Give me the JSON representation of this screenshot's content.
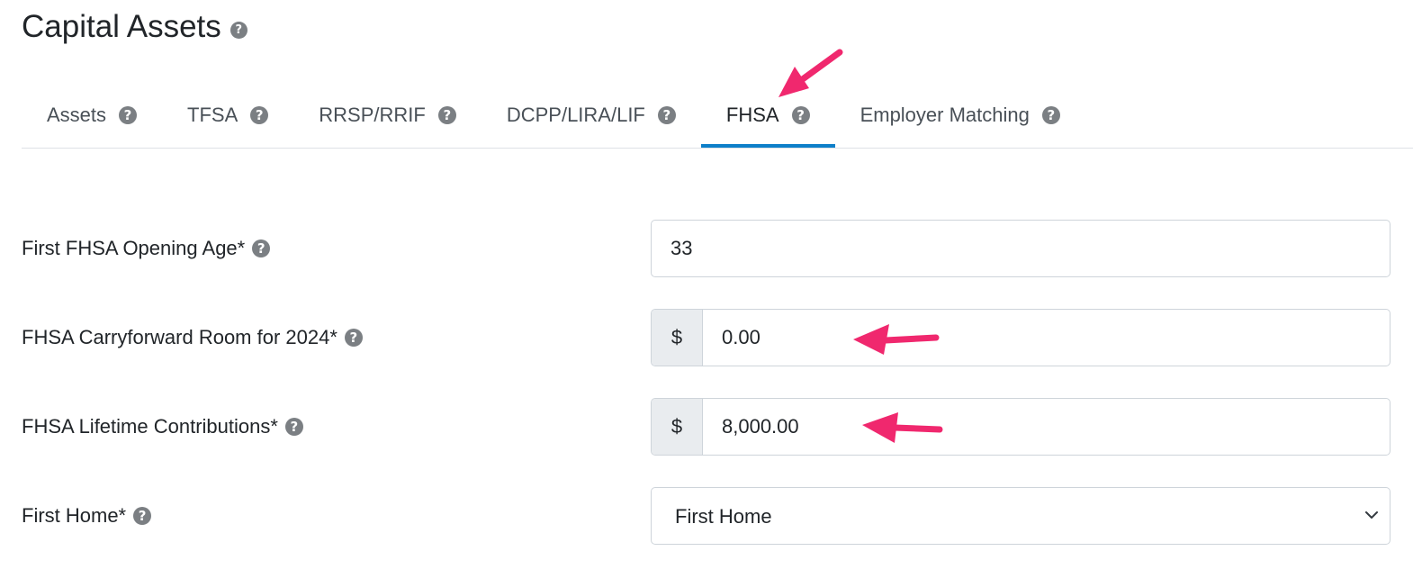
{
  "page": {
    "title": "Capital Assets"
  },
  "tabs": [
    {
      "label": "Assets"
    },
    {
      "label": "TFSA"
    },
    {
      "label": "RRSP/RRIF"
    },
    {
      "label": "DCPP/LIRA/LIF"
    },
    {
      "label": "FHSA",
      "active": true
    },
    {
      "label": "Employer Matching"
    }
  ],
  "form": {
    "opening_age": {
      "label": "First FHSA Opening Age*",
      "value": "33"
    },
    "carryforward": {
      "label": "FHSA Carryforward Room for 2024*",
      "prefix": "$",
      "value": "0.00"
    },
    "lifetime": {
      "label": "FHSA Lifetime Contributions*",
      "prefix": "$",
      "value": "8,000.00"
    },
    "first_home": {
      "label": "First Home*",
      "selected": "First Home"
    }
  },
  "icons": {
    "help": "question-circle-icon",
    "dropdown": "chevron-down-icon",
    "annotation": "arrow-icon"
  },
  "colors": {
    "accent": "#0d7fc9",
    "annotation": "#f0286e",
    "help_icon": "#7b7f83"
  }
}
